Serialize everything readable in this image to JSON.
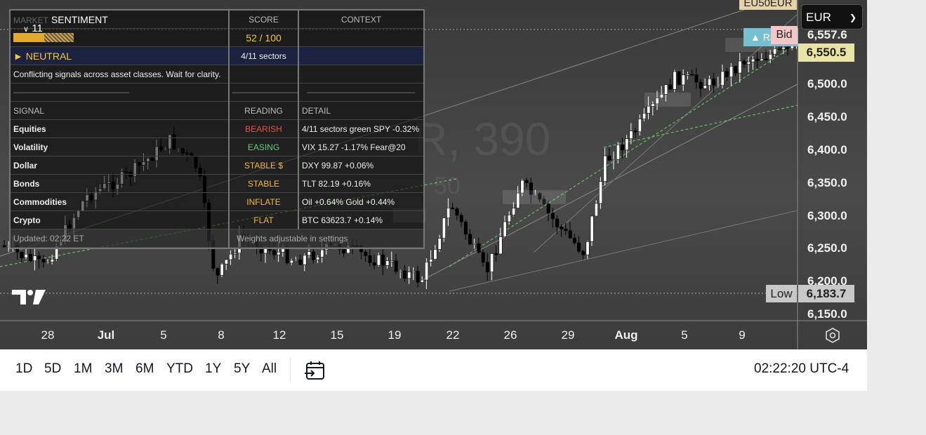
{
  "chart": {
    "symbol": "EU50EUR",
    "watermark_text": "R, 390",
    "watermark_sub": "50",
    "currency": "EUR",
    "bid_label": "Bid",
    "last_price": "6,550.5",
    "ask_partial": "6,557.6",
    "low_label": "Low",
    "low_value": "6,183.7",
    "blue_label": "▲ Ra",
    "y_axis": [
      "6,500.0",
      "6,450.0",
      "6,400.0",
      "6,350.0",
      "6,300.0",
      "6,250.0",
      "6,200.0",
      "6,150.0"
    ],
    "x_axis": [
      {
        "label": "28",
        "bold": false
      },
      {
        "label": "Jul",
        "bold": true
      },
      {
        "label": "5",
        "bold": false
      },
      {
        "label": "8",
        "bold": false
      },
      {
        "label": "12",
        "bold": false
      },
      {
        "label": "15",
        "bold": false
      },
      {
        "label": "19",
        "bold": false
      },
      {
        "label": "22",
        "bold": false
      },
      {
        "label": "26",
        "bold": false
      },
      {
        "label": "29",
        "bold": false
      },
      {
        "label": "Aug",
        "bold": true
      },
      {
        "label": "5",
        "bold": false
      },
      {
        "label": "9",
        "bold": false
      }
    ],
    "colors": {
      "up": "#ffffff",
      "down": "#000000",
      "trend": "#5ec25e",
      "panel_accent": "#f5c542"
    }
  },
  "sentiment": {
    "badge": "11",
    "title": "SENTIMENT",
    "title_prefix": "MARKET",
    "col_score": "SCORE",
    "col_context": "CONTEXT",
    "score": "52 / 100",
    "state": "► NEUTRAL",
    "sectors": "4/11 sectors",
    "message": "Conflicting signals across asset classes. Wait for clarity.",
    "dashes_a": "———————————————",
    "dashes_b": "—————————",
    "dashes_c": "——————————————",
    "col_signal": "SIGNAL",
    "col_reading": "READING",
    "col_detail": "DETAIL",
    "rows": [
      {
        "signal": "Equities",
        "reading": "BEARISH",
        "detail": "4/11 sectors green  SPY -0.32%"
      },
      {
        "signal": "Volatility",
        "reading": "EASING",
        "detail": "VIX 15.27  -1.17%  Fear@20"
      },
      {
        "signal": "Dollar",
        "reading": "STABLE $",
        "detail": "DXY 99.87  +0.06%"
      },
      {
        "signal": "Bonds",
        "reading": "STABLE",
        "detail": "TLT 82.19  +0.16%"
      },
      {
        "signal": "Commodities",
        "reading": "INFLATE",
        "detail": "Oil +0.64%  Gold +0.44%"
      },
      {
        "signal": "Crypto",
        "reading": "FLAT",
        "detail": "BTC 63623.7  +0.14%"
      }
    ],
    "updated": "Updated: 02:22 ET",
    "weights_note": "Weights adjustable in settings"
  },
  "toolbar": {
    "ranges": [
      "1D",
      "5D",
      "1M",
      "3M",
      "6M",
      "YTD",
      "1Y",
      "5Y",
      "All"
    ],
    "clock": "02:22:20 UTC-4"
  }
}
